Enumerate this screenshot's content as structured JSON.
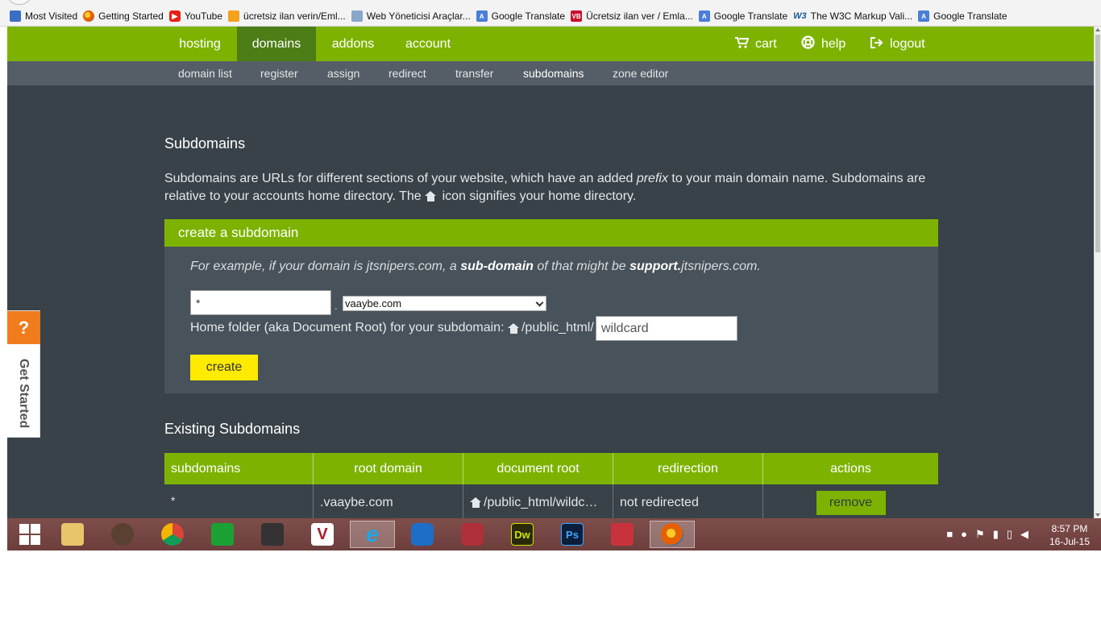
{
  "bookmarks": [
    {
      "label": "Most Visited",
      "icon": "most-visited-icon"
    },
    {
      "label": "Getting Started",
      "icon": "firefox-icon"
    },
    {
      "label": "YouTube",
      "icon": "youtube-icon"
    },
    {
      "label": "ücretsiz ilan verin/Eml...",
      "icon": "rss-icon"
    },
    {
      "label": "Web Yöneticisi Araçlar...",
      "icon": "webmaster-icon"
    },
    {
      "label": "Google Translate",
      "icon": "google-translate-icon"
    },
    {
      "label": "Ücretsiz ilan ver / Emla...",
      "icon": "vb-icon"
    },
    {
      "label": "Google Translate",
      "icon": "google-translate-icon"
    },
    {
      "label": "The W3C Markup Vali...",
      "icon": "w3c-icon"
    },
    {
      "label": "Google Translate",
      "icon": "google-translate-icon"
    }
  ],
  "mainnav": {
    "tabs": [
      "hosting",
      "domains",
      "addons",
      "account"
    ],
    "active": "domains",
    "cart": "cart",
    "help": "help",
    "logout": "logout"
  },
  "subnav": {
    "items": [
      "domain list",
      "register",
      "assign",
      "redirect",
      "transfer",
      "subdomains",
      "zone editor"
    ],
    "active": "subdomains"
  },
  "page": {
    "title": "Subdomains",
    "desc_a": "Subdomains are URLs for different sections of your website, which have an added",
    "desc_prefix": "prefix",
    "desc_b": "to your main domain name. Subdomains are",
    "desc_c": "relative to your accounts home directory. The",
    "desc_d": "icon signifies your home directory."
  },
  "create": {
    "heading": "create a subdomain",
    "ex_a": "For example, if your domain is jtsnipers.com, a",
    "ex_b": "sub-domain",
    "ex_c": "of that might be",
    "ex_d": "support.",
    "ex_e": "jtsnipers.com.",
    "prefix_value": "*",
    "dot": ".",
    "domain_selected": "vaaybe.com",
    "home_label": "Home folder (aka Document Root) for your subdomain:",
    "home_path": "/public_html/",
    "folder_value": "wildcard",
    "button": "create"
  },
  "existing": {
    "title": "Existing Subdomains",
    "headers": [
      "subdomains",
      "root domain",
      "document root",
      "redirection",
      "actions"
    ],
    "rows": [
      {
        "subdomain": "*",
        "root": ".vaaybe.com",
        "docroot": "/public_html/wildc…",
        "redirection": "not redirected",
        "action": "remove"
      }
    ]
  },
  "getstarted": {
    "q": "?",
    "label": "Get Started"
  },
  "taskbar": {
    "time": "8:57 PM",
    "date": "16-Jul-15"
  },
  "colors": {
    "green": "#7db300",
    "dark_green": "#4c7d16",
    "bg": "#394248",
    "subnav": "#555e66",
    "yellow": "#ffea00",
    "orange": "#f07c1d"
  }
}
